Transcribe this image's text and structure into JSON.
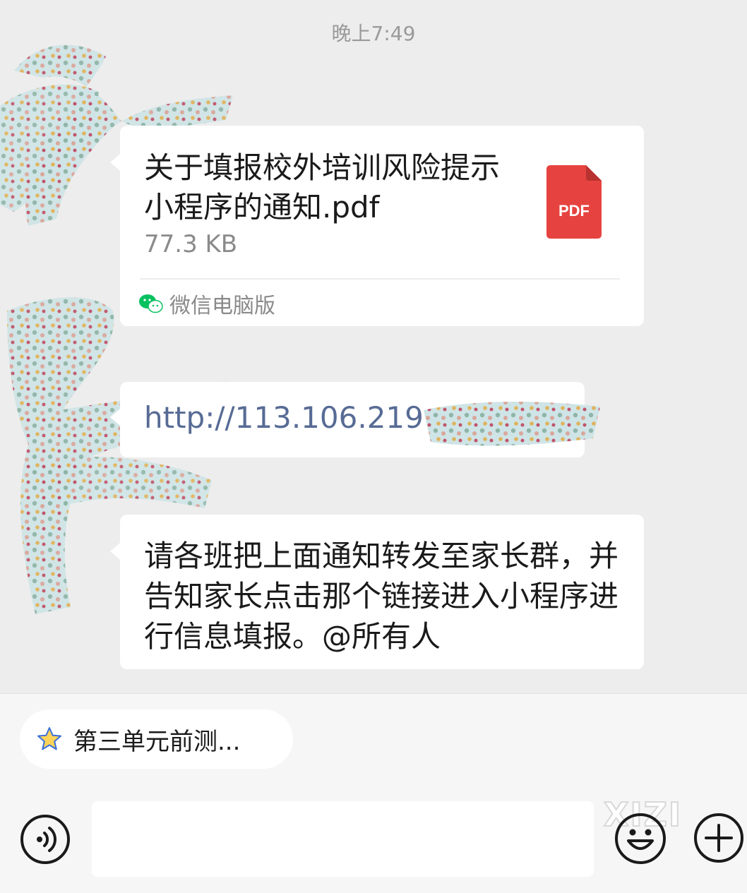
{
  "timestamp": "晚上7:49",
  "messages": {
    "file": {
      "title": "关于填报校外培训风险提示小程序的通知.pdf",
      "size": "77.3 KB",
      "icon_label": "PDF",
      "source": "微信电脑版"
    },
    "link": {
      "text": "http://113.106.219"
    },
    "text": {
      "content": "请各班把上面通知转发至家长群，并告知家长点击那个链接进入小程序进行信息填报。@所有人"
    }
  },
  "quick_reply": {
    "label": "第三单元前测..."
  },
  "input_bar": {
    "watermark": "XIZI"
  },
  "icons": {
    "voice": "voice-icon",
    "emoji": "emoji-icon",
    "plus": "plus-icon",
    "star": "star-icon",
    "pdf": "pdf-icon",
    "wechat": "wechat-icon"
  },
  "colors": {
    "background": "#ededed",
    "bubble": "#ffffff",
    "link": "#576b95",
    "pdf_red": "#e64340",
    "wechat_green": "#07c160"
  }
}
